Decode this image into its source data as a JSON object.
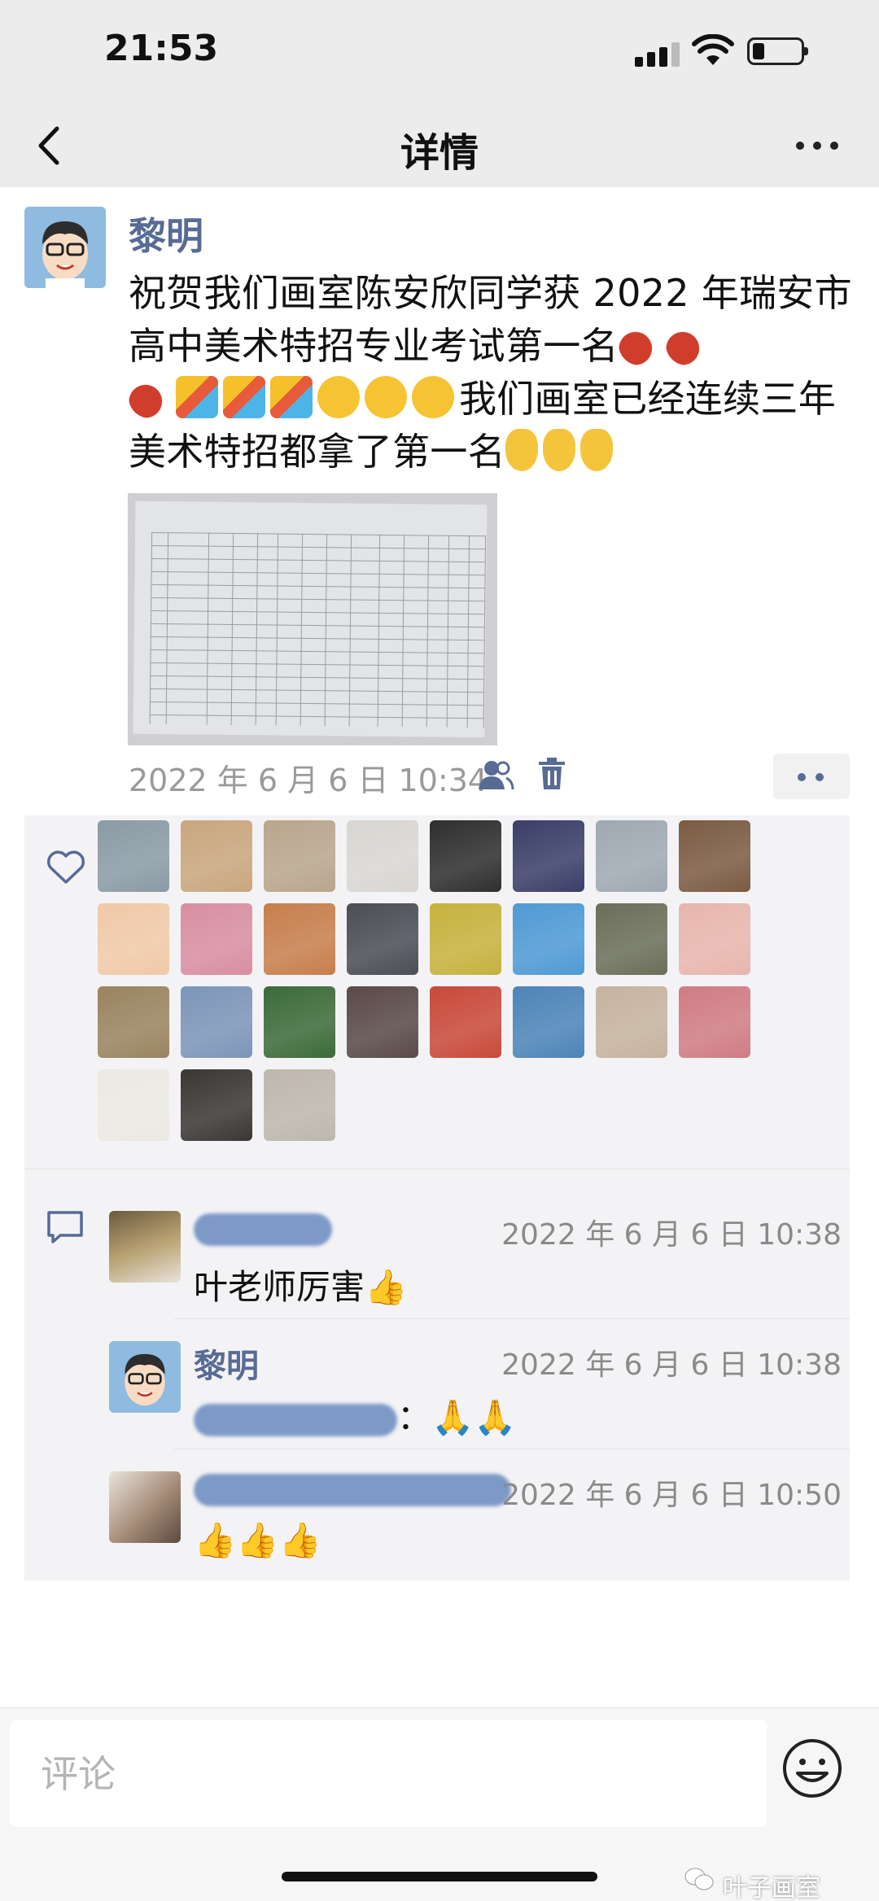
{
  "status": {
    "time": "21:53"
  },
  "nav": {
    "title": "详情"
  },
  "post": {
    "author": "黎明",
    "text_part1": "祝贺我们画室陈安欣同学获 2022 年瑞安市高中美术特招专业考试第一名",
    "text_part2": "我们画室已经连续三年美术特招都拿了第一名",
    "emoji_line1": [
      "firecracker",
      "firecracker",
      "firecracker",
      "party-popper",
      "party-popper",
      "party-popper",
      "hugging-face",
      "hugging-face",
      "hugging-face"
    ],
    "emoji_line2": [
      "point-up",
      "point-up",
      "point-up"
    ],
    "date": "2022 年 6 月 6 日 10:34"
  },
  "likes": {
    "count": 27,
    "colors": [
      "#8a9ba5",
      "#c9a67e",
      "#b8a68d",
      "#d9d6d2",
      "#2f2f30",
      "#3b3f68",
      "#9fa9b2",
      "#7b5c43",
      "#f0c9a8",
      "#d88ea3",
      "#c67f4d",
      "#4b4e55",
      "#c6b23e",
      "#4f9ad4",
      "#6a6f5a",
      "#e7b6ad",
      "#9a8460",
      "#7c95b9",
      "#3c6b3a",
      "#5a4a48",
      "#c84a3a",
      "#4d84b8",
      "#c5b39e",
      "#cf7c84",
      "#ece9e3",
      "#3b3735",
      "#bdb7ad"
    ]
  },
  "comments": [
    {
      "name": "",
      "time": "2022 年 6 月 6 日 10:38",
      "text": "叶老师厉害",
      "emoji": "👍"
    },
    {
      "name": "黎明",
      "time": "2022 年 6 月 6 日 10:38",
      "text_suffix": "：",
      "emoji": "🙏🙏"
    },
    {
      "name": "",
      "time": "2022 年 6 月 6 日 10:50",
      "emoji": "👍👍👍"
    }
  ],
  "input": {
    "placeholder": "评论"
  },
  "watermark": "叶子画室"
}
